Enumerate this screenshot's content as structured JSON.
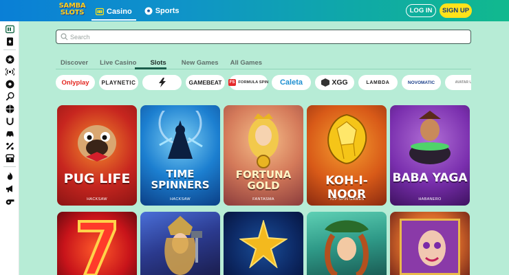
{
  "header": {
    "logo_line1": "SAMBA",
    "logo_line2": "SLOTS",
    "nav": [
      {
        "label": "Casino",
        "icon": "casino-icon",
        "active": true
      },
      {
        "label": "Sports",
        "icon": "sports-ball-icon",
        "active": false
      }
    ],
    "login_label": "LOG IN",
    "signup_label": "SIGN UP"
  },
  "sidebar": {
    "icons": [
      "casino-icon",
      "cards-icon",
      "star-badge-icon",
      "live-broadcast-icon",
      "football-icon",
      "tennis-icon",
      "basketball-icon",
      "horseshoe-icon",
      "car-icon",
      "esports-icon",
      "treasure-chest-icon",
      "flame-icon",
      "megaphone-icon",
      "whistle-icon"
    ]
  },
  "search": {
    "placeholder": "Search"
  },
  "tabs": [
    "Discover",
    "Live Casino",
    "Slots",
    "New Games",
    "All Games"
  ],
  "active_tab": "Slots",
  "providers": [
    "Onlyplay",
    "PLAYNETIC",
    "",
    "GAMEBEAT",
    "FORMULA SPIN",
    "Caleta",
    "XGG",
    "LAMBDA",
    "NOVOMATIC",
    "AVATAR UX"
  ],
  "games_row1": [
    {
      "title": "PUG LIFE",
      "provider": "HACKSAW"
    },
    {
      "title": "TIME SPINNERS",
      "provider": "HACKSAW"
    },
    {
      "title": "FORTUNA GOLD",
      "provider": "FANTASMA"
    },
    {
      "title": "KOH-I-NOOR",
      "provider": "TOP SPIN GAMES"
    },
    {
      "title": "BABA YAGA",
      "provider": "HABANERO"
    }
  ],
  "games_row2": [
    {
      "title": "",
      "provider": ""
    },
    {
      "title": "",
      "provider": ""
    },
    {
      "title": "",
      "provider": ""
    },
    {
      "title": "",
      "provider": ""
    },
    {
      "title": "",
      "provider": ""
    }
  ],
  "colors": {
    "accent": "#ffe21a",
    "background": "#b7ecd6",
    "header_start": "#0a7fd6",
    "header_end": "#11b98e"
  }
}
